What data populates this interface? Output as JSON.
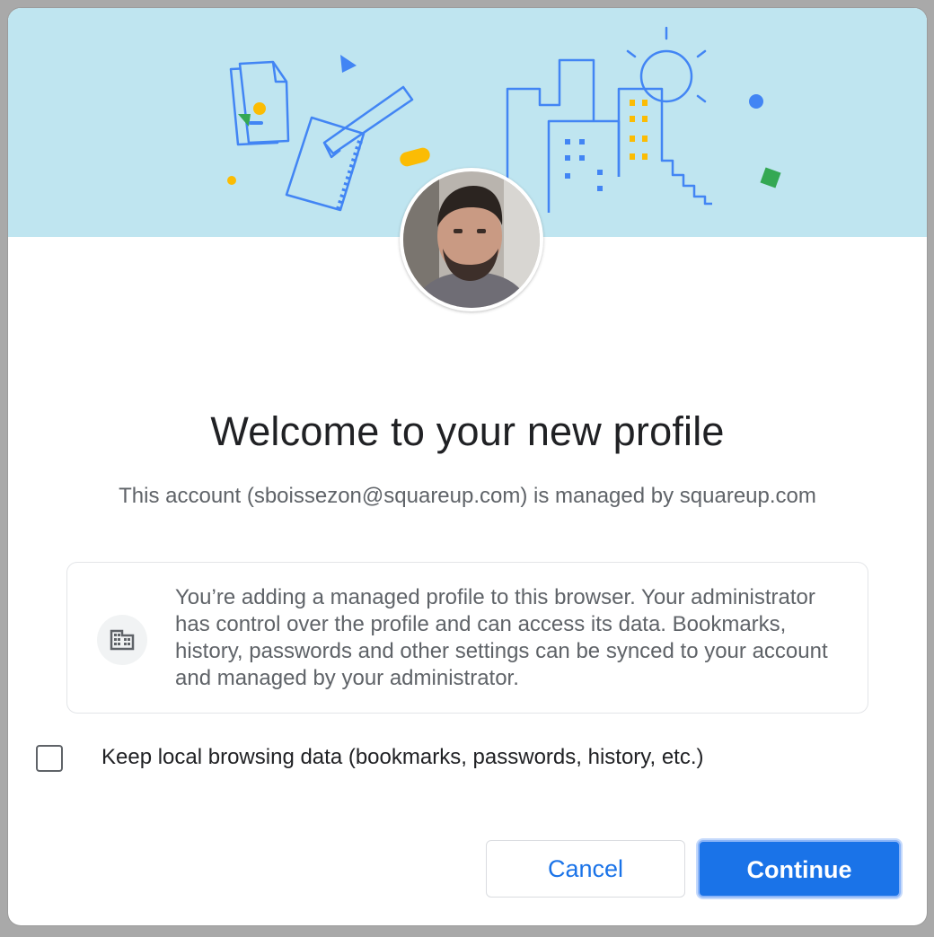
{
  "dialog": {
    "title": "Welcome to your new profile",
    "subtitle": "This account (sboissezon@squareup.com) is managed by squareup.com"
  },
  "info": {
    "icon": "building-icon",
    "text": "You’re adding a managed profile to this browser. Your administrator has control over the profile and can access its data. Bookmarks, history, passwords and other settings can be synced to your account and managed by your administrator."
  },
  "option": {
    "label": "Keep local browsing data (bookmarks, passwords, history, etc.)",
    "checked": false
  },
  "buttons": {
    "cancel_label": "Cancel",
    "continue_label": "Continue"
  },
  "colors": {
    "banner": "#bfe5f0",
    "accent": "#1a73e8",
    "illustration": "#4285f4",
    "yellow": "#fbbc04",
    "green": "#34a853"
  }
}
